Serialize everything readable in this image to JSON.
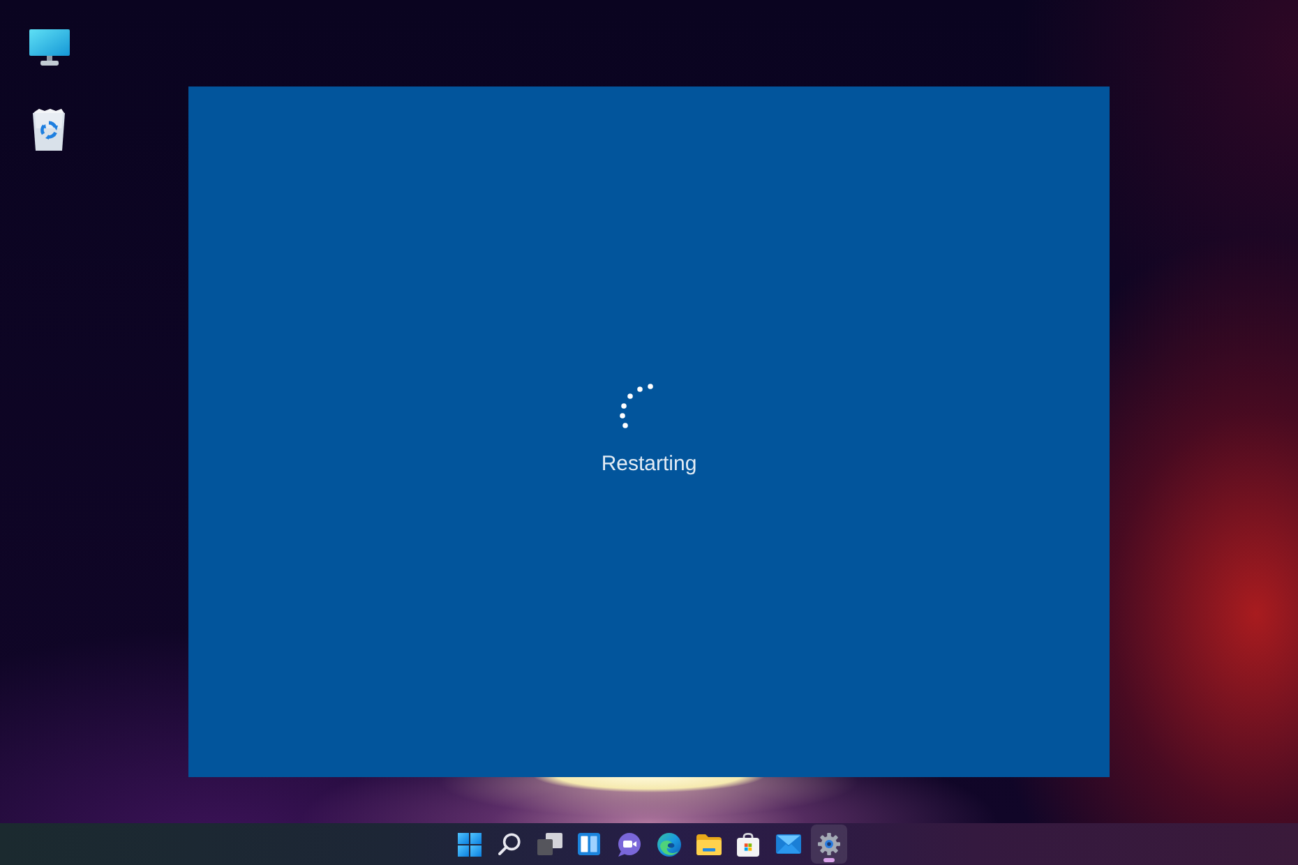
{
  "desktop_icons": [
    {
      "kind": "computer"
    },
    {
      "kind": "recycle-bin"
    }
  ],
  "restart_screen": {
    "message": "Restarting"
  },
  "taskbar": {
    "items": [
      {
        "kind": "start",
        "selected": false
      },
      {
        "kind": "search",
        "selected": false
      },
      {
        "kind": "task-view",
        "selected": false
      },
      {
        "kind": "widgets",
        "selected": false
      },
      {
        "kind": "chat",
        "selected": false
      },
      {
        "kind": "browser",
        "selected": false
      },
      {
        "kind": "files",
        "selected": false
      },
      {
        "kind": "store",
        "selected": false
      },
      {
        "kind": "mail",
        "selected": false
      },
      {
        "kind": "settings",
        "selected": true
      }
    ]
  }
}
